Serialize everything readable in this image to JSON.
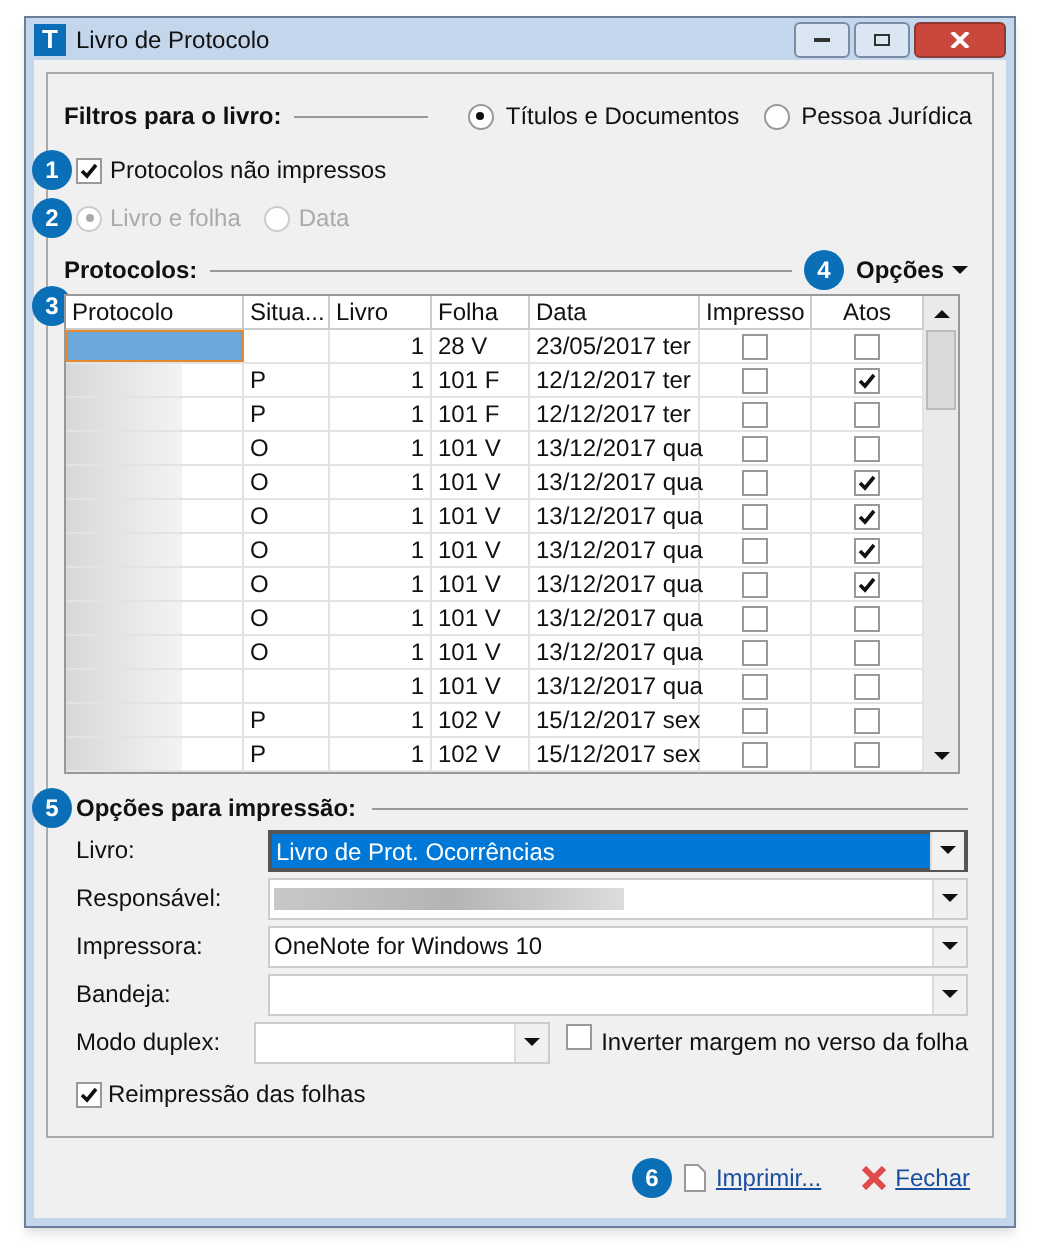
{
  "window": {
    "title": "Livro de Protocolo",
    "app_icon": "T"
  },
  "filters": {
    "label": "Filtros para o livro:",
    "options": [
      {
        "label": "Títulos e Documentos",
        "selected": true
      },
      {
        "label": "Pessoa Jurídica",
        "selected": false
      }
    ]
  },
  "unprinted": {
    "marker": "1",
    "label": "Protocolos não impressos",
    "checked": true
  },
  "order": {
    "marker": "2",
    "disabled": true,
    "options": [
      {
        "label": "Livro e folha",
        "selected": true
      },
      {
        "label": "Data",
        "selected": false
      }
    ]
  },
  "protocols": {
    "label": "Protocolos:",
    "marker": "3",
    "options_marker": "4",
    "options_label": "Opções",
    "table": {
      "columns": [
        "Protocolo",
        "Situa...",
        "Livro",
        "Folha",
        "Data",
        "Impresso",
        "Atos"
      ],
      "rows": [
        {
          "selected": true,
          "livro": "1",
          "folha": "28 V",
          "data": "23/05/2017 ter",
          "impresso": false,
          "atos": false
        },
        {
          "selected": false,
          "situacao": "P",
          "livro": "1",
          "folha": "101 F",
          "data": "12/12/2017 ter",
          "impresso": false,
          "atos": true
        },
        {
          "selected": false,
          "situacao": "P",
          "livro": "1",
          "folha": "101 F",
          "data": "12/12/2017 ter",
          "impresso": false,
          "atos": false
        },
        {
          "selected": false,
          "situacao": "O",
          "livro": "1",
          "folha": "101 V",
          "data": "13/12/2017 qua",
          "impresso": false,
          "atos": false
        },
        {
          "selected": false,
          "situacao": "O",
          "livro": "1",
          "folha": "101 V",
          "data": "13/12/2017 qua",
          "impresso": false,
          "atos": true
        },
        {
          "selected": false,
          "situacao": "O",
          "livro": "1",
          "folha": "101 V",
          "data": "13/12/2017 qua",
          "impresso": false,
          "atos": true
        },
        {
          "selected": false,
          "situacao": "O",
          "livro": "1",
          "folha": "101 V",
          "data": "13/12/2017 qua",
          "impresso": false,
          "atos": true
        },
        {
          "selected": false,
          "situacao": "O",
          "livro": "1",
          "folha": "101 V",
          "data": "13/12/2017 qua",
          "impresso": false,
          "atos": true
        },
        {
          "selected": false,
          "situacao": "O",
          "livro": "1",
          "folha": "101 V",
          "data": "13/12/2017 qua",
          "impresso": false,
          "atos": false
        },
        {
          "selected": false,
          "situacao": "O",
          "livro": "1",
          "folha": "101 V",
          "data": "13/12/2017 qua",
          "impresso": false,
          "atos": false
        },
        {
          "selected": false,
          "livro": "1",
          "folha": "101 V",
          "data": "13/12/2017 qua",
          "impresso": false,
          "atos": false
        },
        {
          "selected": false,
          "situacao": "P",
          "livro": "1",
          "folha": "102 V",
          "data": "15/12/2017 sex",
          "impresso": false,
          "atos": false
        },
        {
          "selected": false,
          "situacao": "P",
          "livro": "1",
          "folha": "102 V",
          "data": "15/12/2017 sex",
          "impresso": false,
          "atos": false
        }
      ]
    }
  },
  "print_options": {
    "marker": "5",
    "label": "Opções para impressão:",
    "fields": [
      {
        "kind": "select",
        "label": "Livro:",
        "value": "Livro de Prot. Ocorrências",
        "focused": true
      },
      {
        "kind": "blurred",
        "label": "Responsável:"
      },
      {
        "kind": "select",
        "label": "Impressora:",
        "value": "OneNote for Windows 10",
        "focused": false
      },
      {
        "kind": "select",
        "label": "Bandeja:",
        "focused": false
      }
    ],
    "duplex": {
      "label": "Modo duplex:",
      "invert_label": "Inverter margem no verso da folha",
      "invert_checked": false
    },
    "reprint": {
      "label": "Reimpressão das folhas",
      "checked": true
    }
  },
  "footer": {
    "marker": "6",
    "print_label": "Imprimir...",
    "close_label": "Fechar"
  }
}
